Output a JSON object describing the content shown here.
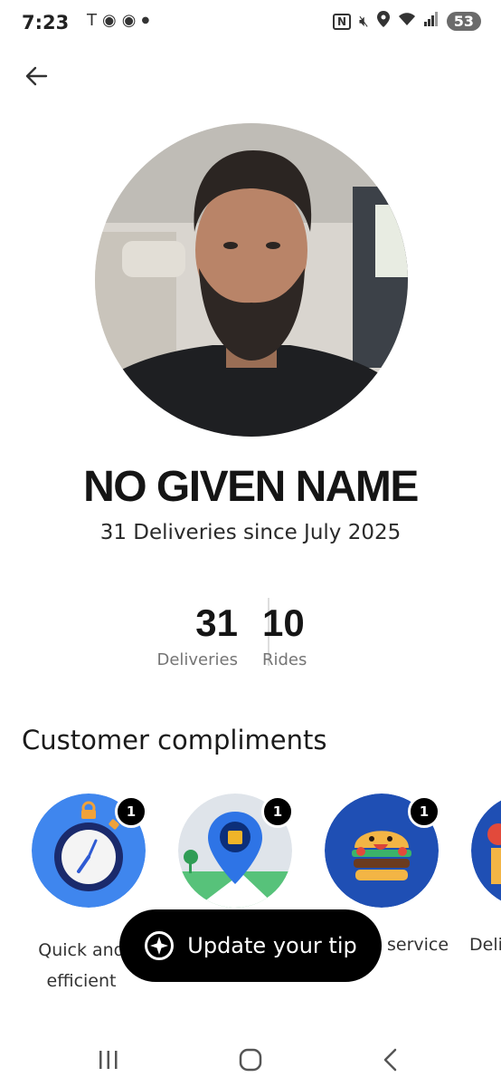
{
  "status_bar": {
    "time": "7:23",
    "battery": "53"
  },
  "profile": {
    "name": "NO GIVEN NAME",
    "subtitle": "31 Deliveries since July 2025"
  },
  "stats": [
    {
      "value": "31",
      "label": "Deliveries"
    },
    {
      "value": "10",
      "label": "Rides"
    }
  ],
  "compliments": {
    "title": "Customer compliments",
    "items": [
      {
        "label": "Quick and efficient",
        "count": "1",
        "icon": "stopwatch-icon"
      },
      {
        "label": "",
        "count": "1",
        "icon": "map-pin-icon"
      },
      {
        "label": "service",
        "count": "1",
        "icon": "burger-icon"
      },
      {
        "label": "Deli",
        "count": "",
        "icon": "delivery-icon"
      }
    ]
  },
  "tip_button": {
    "label": "Update your tip"
  },
  "colors": {
    "badge_blue": "#3f86ee",
    "dark_blue": "#1f4fb4",
    "text": "#151515",
    "muted": "#757575"
  }
}
